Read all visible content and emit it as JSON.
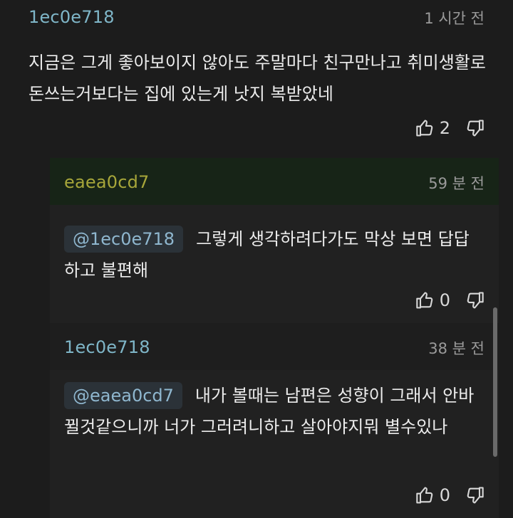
{
  "comments": [
    {
      "author": "1ec0e718",
      "time": "1 시간 전",
      "text": "지금은 그게 좋아보이지 않아도 주말마다 친구만나고 취미생활로 돈쓰는거보다는 집에 있는게 낫지 복받았네",
      "likes": "2"
    }
  ],
  "replies": [
    {
      "author": "eaea0cd7",
      "time": "59 분 전",
      "mention": "@1ec0e718",
      "text": "그렇게 생각하려다가도 막상 보면 답답하고 불편해",
      "likes": "0"
    },
    {
      "author": "1ec0e718",
      "time": "38 분 전",
      "mention": "@eaea0cd7",
      "text": "내가 볼때는 남편은 성향이 그래서 안바뀔것같으니까 너가 그러려니하고 살아야지뭐 별수있나",
      "likes": "0"
    }
  ],
  "colors": {
    "background": "#1c1c1c",
    "author_blue": "#7fb6c8",
    "author_olive": "#a7a63a",
    "reply_header": "#172417"
  },
  "icons": {
    "like": "thumbs-up-icon",
    "dislike": "thumbs-down-icon"
  }
}
